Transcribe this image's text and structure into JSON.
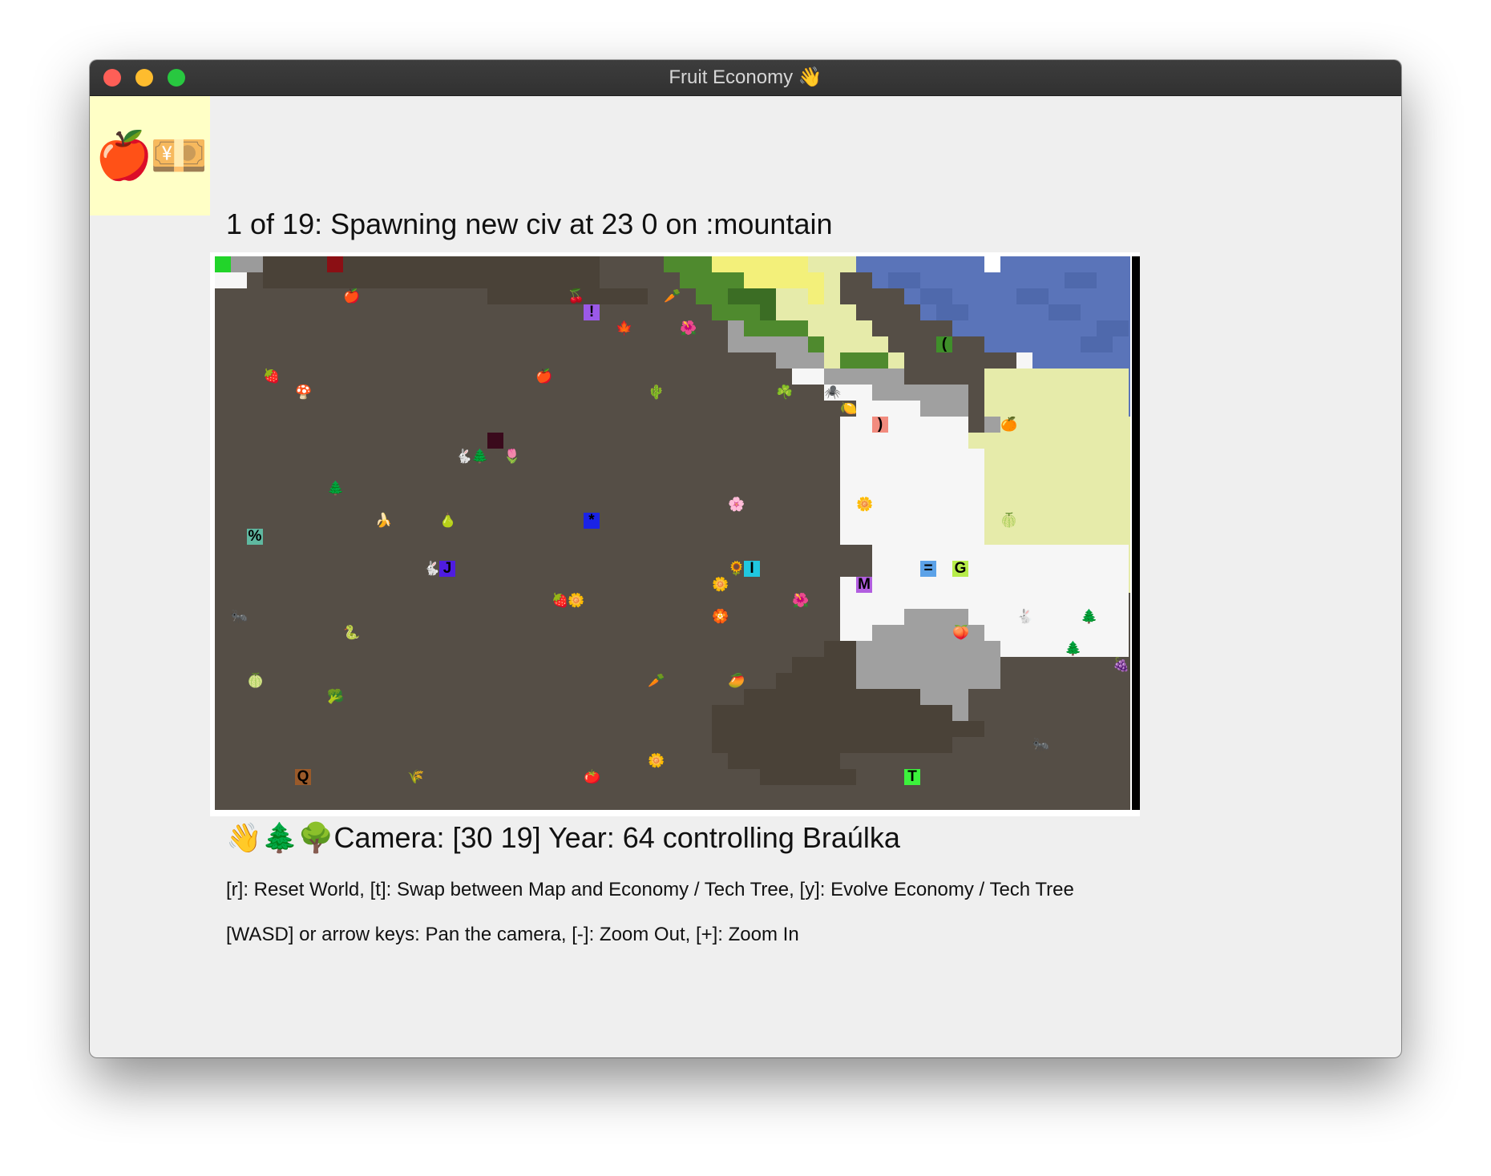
{
  "window": {
    "title": "Fruit Economy 👋"
  },
  "logo": {
    "text": "🍎💴"
  },
  "status_text": "1 of 19: Spawning new civ at 23 0 on :mountain",
  "info_line": "👋🌲🌳Camera: [30 19] Year: 64 controlling Braúlka",
  "help_lines": [
    "[r]: Reset World, [t]: Swap between Map and Economy / Tech Tree, [y]: Evolve Economy / Tech Tree",
    "[WASD] or arrow keys: Pan the camera, [-]: Zoom Out, [+]: Zoom In"
  ],
  "map": {
    "emojis": [
      {
        "g": "🍎",
        "c": 8,
        "r": 2
      },
      {
        "g": "🍒",
        "c": 22,
        "r": 2
      },
      {
        "g": "🥕",
        "c": 28,
        "r": 2
      },
      {
        "g": "🍁",
        "c": 25,
        "r": 4
      },
      {
        "g": "🌺",
        "c": 29,
        "r": 4
      },
      {
        "g": "🍓",
        "c": 3,
        "r": 7
      },
      {
        "g": "🍄",
        "c": 5,
        "r": 8
      },
      {
        "g": "🍎",
        "c": 20,
        "r": 7
      },
      {
        "g": "🌵",
        "c": 27,
        "r": 8
      },
      {
        "g": "☘️",
        "c": 35,
        "r": 8
      },
      {
        "g": "🕷️",
        "c": 38,
        "r": 8
      },
      {
        "g": "🍋",
        "c": 39,
        "r": 9
      },
      {
        "g": "🍊",
        "c": 49,
        "r": 10
      },
      {
        "g": "🐇",
        "c": 15,
        "r": 12
      },
      {
        "g": "🌲",
        "c": 16,
        "r": 12
      },
      {
        "g": "🌷",
        "c": 18,
        "r": 12
      },
      {
        "g": "🌲",
        "c": 7,
        "r": 14
      },
      {
        "g": "🍌",
        "c": 10,
        "r": 16
      },
      {
        "g": "🍐",
        "c": 14,
        "r": 16
      },
      {
        "g": "🌸",
        "c": 32,
        "r": 15
      },
      {
        "g": "🌼",
        "c": 40,
        "r": 15
      },
      {
        "g": "🍈",
        "c": 49,
        "r": 16
      },
      {
        "g": "🐇",
        "c": 13,
        "r": 19
      },
      {
        "g": "🌻",
        "c": 32,
        "r": 19
      },
      {
        "g": "🌼",
        "c": 31,
        "r": 20
      },
      {
        "g": "🍓",
        "c": 21,
        "r": 21
      },
      {
        "g": "🌼",
        "c": 22,
        "r": 21
      },
      {
        "g": "🌺",
        "c": 36,
        "r": 21
      },
      {
        "g": "🐜",
        "c": 1,
        "r": 22
      },
      {
        "g": "🏵️",
        "c": 31,
        "r": 22
      },
      {
        "g": "🐇",
        "c": 50,
        "r": 22
      },
      {
        "g": "🌲",
        "c": 54,
        "r": 22
      },
      {
        "g": "🐍",
        "c": 8,
        "r": 23
      },
      {
        "g": "🍑",
        "c": 46,
        "r": 23
      },
      {
        "g": "🌲",
        "c": 53,
        "r": 24
      },
      {
        "g": "🍇",
        "c": 56,
        "r": 25
      },
      {
        "g": "🍈",
        "c": 2,
        "r": 26
      },
      {
        "g": "🥦",
        "c": 7,
        "r": 27
      },
      {
        "g": "🥕",
        "c": 27,
        "r": 26
      },
      {
        "g": "🥭",
        "c": 32,
        "r": 26
      },
      {
        "g": "🐜",
        "c": 51,
        "r": 30
      },
      {
        "g": "🌼",
        "c": 27,
        "r": 31
      },
      {
        "g": "🌾",
        "c": 12,
        "r": 32
      },
      {
        "g": "🍅",
        "c": 23,
        "r": 32
      }
    ],
    "civ_markers": [
      {
        "ch": "",
        "c": 7,
        "r": 0,
        "bg": "#8b0f14"
      },
      {
        "ch": "!",
        "c": 23,
        "r": 3,
        "bg": "#9b59e8"
      },
      {
        "ch": "",
        "c": 17,
        "r": 11,
        "bg": "#3a0a1c"
      },
      {
        "ch": ")",
        "c": 41,
        "r": 10,
        "bg": "#f28b7e"
      },
      {
        "ch": "(",
        "c": 45,
        "r": 5,
        "bg": "#3f8f2a"
      },
      {
        "ch": "%",
        "c": 2,
        "r": 17,
        "bg": "#5fb8a0"
      },
      {
        "ch": "*",
        "c": 23,
        "r": 16,
        "bg": "#1a23e6"
      },
      {
        "ch": "J",
        "c": 14,
        "r": 19,
        "bg": "#4e1ce0"
      },
      {
        "ch": "I",
        "c": 33,
        "r": 19,
        "bg": "#20c8e0"
      },
      {
        "ch": "=",
        "c": 44,
        "r": 19,
        "bg": "#5ca2e8"
      },
      {
        "ch": "G",
        "c": 46,
        "r": 19,
        "bg": "#b7ec4a"
      },
      {
        "ch": "M",
        "c": 40,
        "r": 20,
        "bg": "#b25ee0"
      },
      {
        "ch": "Q",
        "c": 5,
        "r": 32,
        "bg": "#9a5a2a"
      },
      {
        "ch": "T",
        "c": 43,
        "r": 32,
        "bg": "#3cf23c"
      },
      {
        "ch": "",
        "c": 0,
        "r": 0,
        "bg": "#22d42a"
      }
    ]
  }
}
